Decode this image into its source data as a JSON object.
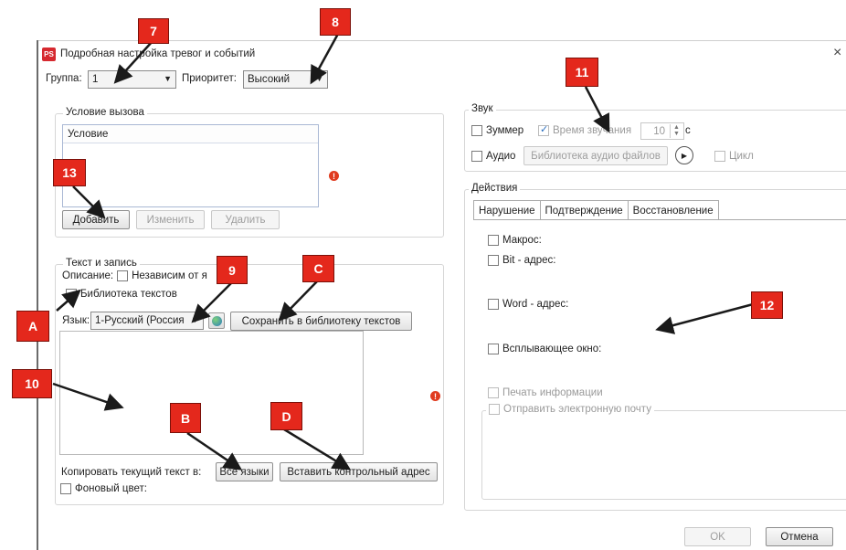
{
  "window": {
    "title": "Подробная настройка тревог и событий",
    "app_icon": "PS",
    "close_glyph": "×"
  },
  "top": {
    "group_label": "Группа:",
    "group_value": "1",
    "priority_label": "Приоритет:",
    "priority_value": "Высокий"
  },
  "trigger": {
    "title": "Условие вызова",
    "column_header": "Условие",
    "add_button": "Добавить",
    "edit_button": "Изменить",
    "delete_button": "Удалить"
  },
  "text_record": {
    "title": "Текст и запись",
    "description_label": "Описание:",
    "independent_label": "Независим от я",
    "library_label": "Библиотека текстов",
    "language_label": "Язык:",
    "language_value": "1-Русский (Россия",
    "save_library_button": "Сохранить в библиотеку текстов",
    "copy_label": "Копировать текущий текст в:",
    "all_languages_button": "Все языки",
    "insert_address_button": "Вставить контрольный адрес",
    "background_label": "Фоновый цвет:"
  },
  "sound": {
    "title": "Звук",
    "buzzer_label": "Зуммер",
    "duration_label": "Время звучания",
    "duration_value": "10",
    "duration_unit": "с",
    "audio_label": "Аудио",
    "audio_library_button": "Библиотека аудио файлов",
    "cycle_label": "Цикл"
  },
  "actions": {
    "title": "Действия",
    "tabs": [
      "Нарушение",
      "Подтверждение",
      "Восстановление"
    ],
    "macro_label": "Макрос:",
    "bit_label": "Bit - адрес:",
    "word_label": "Word - адрес:",
    "popup_label": "Всплывающее окно:",
    "print_label": "Печать информации",
    "email_label": "Отправить электронную почту"
  },
  "footer": {
    "ok_button": "OK",
    "cancel_button": "Отмена"
  },
  "callouts": {
    "c7": "7",
    "c8": "8",
    "c9": "9",
    "c10": "10",
    "c11": "11",
    "c12": "12",
    "c13": "13",
    "cA": "A",
    "cB": "B",
    "cC": "C",
    "cD": "D"
  },
  "colors": {
    "callout": "#e4281c",
    "warning": "#e03b1f"
  }
}
